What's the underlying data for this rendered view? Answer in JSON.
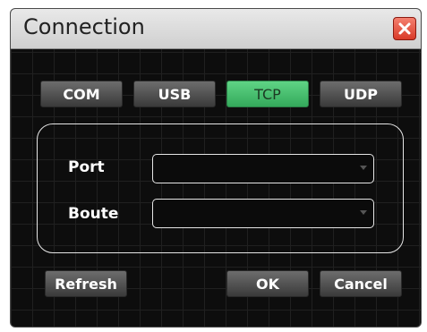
{
  "dialog": {
    "title": "Connection"
  },
  "tabs": [
    {
      "label": "COM",
      "active": false
    },
    {
      "label": "USB",
      "active": false
    },
    {
      "label": "TCP",
      "active": true
    },
    {
      "label": "UDP",
      "active": false
    }
  ],
  "fields": {
    "port": {
      "label": "Port",
      "value": ""
    },
    "route": {
      "label": "Boute",
      "value": ""
    }
  },
  "buttons": {
    "refresh": "Refresh",
    "ok": "OK",
    "cancel": "Cancel"
  },
  "icons": {
    "close": "close-icon",
    "dropdown": "chevron-down-icon"
  },
  "colors": {
    "active_tab": "#4cc575",
    "close_button": "#e8503d",
    "background": "#0d0d0d"
  }
}
